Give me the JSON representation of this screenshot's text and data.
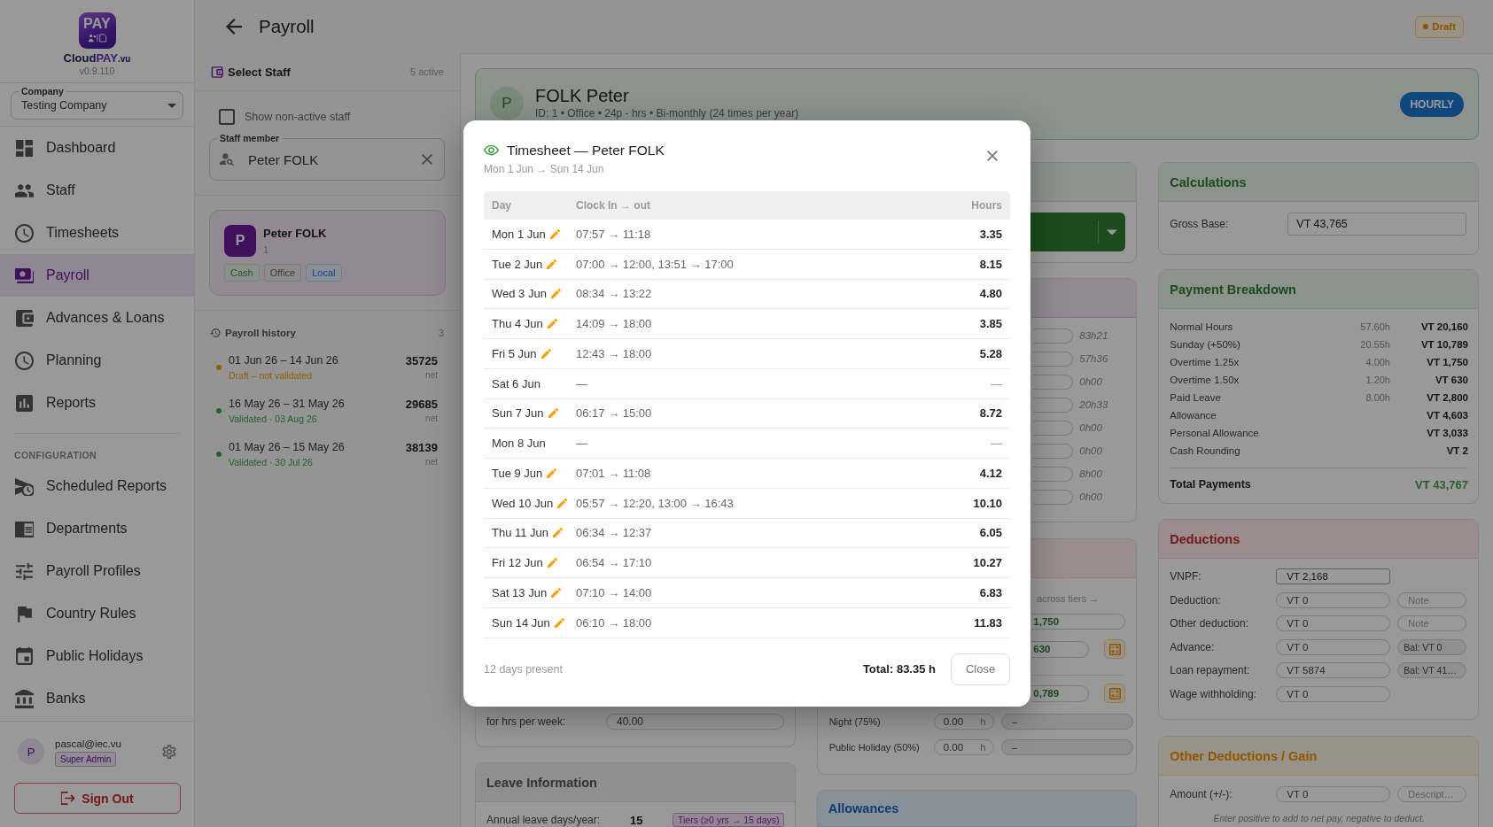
{
  "sidebar": {
    "logo_text": "PAY",
    "brand": {
      "name": "Cloud",
      "accent": "PAY",
      "suffix": ".vu"
    },
    "version": "v0.9.110",
    "company": {
      "label": "Company",
      "value": "Testing Company"
    },
    "sections": [
      {
        "items": [
          {
            "label": "Dashboard",
            "selected": false
          },
          {
            "label": "Staff",
            "selected": false
          },
          {
            "label": "Timesheets",
            "selected": false
          },
          {
            "label": "Payroll",
            "selected": true
          },
          {
            "label": "Advances & Loans",
            "selected": false
          },
          {
            "label": "Planning",
            "selected": false
          },
          {
            "label": "Reports",
            "selected": false
          }
        ]
      },
      {
        "heading": "CONFIGURATION",
        "items": [
          {
            "label": "Scheduled Reports",
            "selected": false
          },
          {
            "label": "Departments",
            "selected": false
          },
          {
            "label": "Payroll Profiles",
            "selected": false
          },
          {
            "label": "Country Rules",
            "selected": false
          },
          {
            "label": "Public Holidays",
            "selected": false
          },
          {
            "label": "Banks",
            "selected": false
          }
        ]
      }
    ],
    "user": {
      "initial": "P",
      "email": "pascal@iec.vu",
      "role": "Super Admin"
    },
    "sign_out": "Sign Out"
  },
  "header": {
    "title": "Payroll",
    "status": "Draft"
  },
  "staff_panel": {
    "title": "Select Staff",
    "count": "5 active",
    "show_inactive": {
      "label": "Show non-active staff",
      "checked": false
    },
    "staff_field": {
      "label": "Staff member",
      "value": "Peter FOLK"
    },
    "selected_staff": {
      "initial": "P",
      "name": "Peter FOLK",
      "id": "1",
      "tags": [
        {
          "label": "Cash",
          "color": "#8a918b"
        },
        {
          "label": "Office",
          "color": "#8d8d8d"
        },
        {
          "label": "Local",
          "color": "#888f97"
        }
      ]
    },
    "history": {
      "title": "Payroll history",
      "count": "3",
      "entries": [
        {
          "period": "01 Jun 26 – 14 Jun 26",
          "status": "Draft – not validated",
          "color": "#915e07",
          "net": "35725",
          "net_label": "net"
        },
        {
          "period": "16 May 26 – 31 May 26",
          "status": "Validated · 03 Aug 26",
          "color": "#28602b",
          "net": "29685",
          "net_label": "net"
        },
        {
          "period": "01 May 26 – 15 May 26",
          "status": "Validated · 30 Jul 26",
          "color": "#28602b",
          "net": "38139",
          "net_label": "net"
        }
      ]
    }
  },
  "employee": {
    "initial": "P",
    "name": "FOLK Peter",
    "details": "ID: 1 • Office • 24p - hrs • Bi-monthly (24 times per year)",
    "pay_type": "HOURLY"
  },
  "work_card": {
    "hours_per_week": {
      "label": "for hrs per week:",
      "value": "40.00"
    }
  },
  "leave_card": {
    "title": "Leave Information",
    "annual_leave": {
      "label": "Annual leave days/year:",
      "value": "15",
      "tier": "Tiers (≥0 yrs → 15 days)"
    }
  },
  "time_card": {
    "durations": [
      "83h21",
      "57h36",
      "0h00",
      "20h33",
      "0h00",
      "0h00",
      "8h00",
      "0h00"
    ]
  },
  "rates_card": {
    "hint": "across tiers →",
    "groups": [
      [
        {
          "kind": "full",
          "value": "1,750"
        },
        {
          "kind": "action",
          "value": "630"
        }
      ],
      [
        {
          "kind": "action",
          "value": "0,789"
        }
      ]
    ],
    "extra_rows": [
      {
        "label": "Night (75%)",
        "hours": "0.00",
        "unit": "h",
        "amount": "–"
      },
      {
        "label": "Public Holiday (50%)",
        "hours": "0.00",
        "unit": "h",
        "amount": "–"
      }
    ]
  },
  "allowances_card": {
    "title": "Allowances"
  },
  "calculations": {
    "title": "Calculations",
    "gross_base": {
      "label": "Gross Base:",
      "value": "VT 43,765"
    }
  },
  "payment_breakdown": {
    "title": "Payment Breakdown",
    "rows": [
      {
        "label": "Normal Hours",
        "hours": "57.60h",
        "amount": "VT 20,160"
      },
      {
        "label": "Sunday (+50%)",
        "hours": "20.55h",
        "amount": "VT 10,789"
      },
      {
        "label": "Overtime 1.25x",
        "hours": "4.00h",
        "amount": "VT 1,750"
      },
      {
        "label": "Overtime 1.50x",
        "hours": "1.20h",
        "amount": "VT 630"
      },
      {
        "label": "Paid Leave",
        "hours": "8.00h",
        "amount": "VT 2,800"
      },
      {
        "label": "Allowance",
        "amount": "VT 4,603"
      },
      {
        "label": "Personal Allowance",
        "amount": "VT 3,033"
      },
      {
        "label": "Cash Rounding",
        "amount": "VT 2"
      }
    ],
    "total": {
      "label": "Total Payments",
      "amount": "VT 43,767"
    }
  },
  "deductions": {
    "title": "Deductions",
    "rows": [
      {
        "kind": "readonly",
        "label": "VNPF:",
        "value": "VT 2,168"
      },
      {
        "kind": "note",
        "label": "Deduction:",
        "value": "VT 0",
        "placeholder": "Note"
      },
      {
        "kind": "note",
        "label": "Other deduction:",
        "value": "VT 0",
        "placeholder": "Note"
      },
      {
        "kind": "balance",
        "label": "Advance:",
        "value": "VT 0",
        "balance": "Bal: VT 0"
      },
      {
        "kind": "balance",
        "label": "Loan repayment:",
        "value": "VT 5874",
        "balance": "Bal: VT 41…"
      },
      {
        "kind": "input",
        "label": "Wage withholding:",
        "value": "VT 0"
      }
    ]
  },
  "other_deductions": {
    "title": "Other Deductions / Gain",
    "amount": {
      "label": "Amount (+/-):",
      "value": "VT 0",
      "placeholder": "Descript…"
    },
    "hint": "Enter positive to add to net pay, negative to deduct."
  },
  "timesheet_dialog": {
    "title": "Timesheet — Peter FOLK",
    "range": "Mon 1 Jun → Sun 14 Jun",
    "columns": [
      "Day",
      "Clock In → out",
      "Hours"
    ],
    "rows": [
      {
        "day": "Mon 1 Jun",
        "present": true,
        "clock": "07:57 → 11:18",
        "hours": "3.35"
      },
      {
        "day": "Tue 2 Jun",
        "present": true,
        "clock": "07:00 → 12:00, 13:51 → 17:00",
        "hours": "8.15"
      },
      {
        "day": "Wed 3 Jun",
        "present": true,
        "clock": "08:34 → 13:22",
        "hours": "4.80"
      },
      {
        "day": "Thu 4 Jun",
        "present": true,
        "clock": "14:09 → 18:00",
        "hours": "3.85"
      },
      {
        "day": "Fri 5 Jun",
        "present": true,
        "clock": "12:43 → 18:00",
        "hours": "5.28"
      },
      {
        "day": "Sat 6 Jun",
        "present": false,
        "clock": "—",
        "hours": "—"
      },
      {
        "day": "Sun 7 Jun",
        "present": true,
        "clock": "06:17 → 15:00",
        "hours": "8.72"
      },
      {
        "day": "Mon 8 Jun",
        "present": false,
        "clock": "—",
        "hours": "—"
      },
      {
        "day": "Tue 9 Jun",
        "present": true,
        "clock": "07:01 → 11:08",
        "hours": "4.12"
      },
      {
        "day": "Wed 10 Jun",
        "present": true,
        "clock": "05:57 → 12:20, 13:00 → 16:43",
        "hours": "10.10"
      },
      {
        "day": "Thu 11 Jun",
        "present": true,
        "clock": "06:34 → 12:37",
        "hours": "6.05"
      },
      {
        "day": "Fri 12 Jun",
        "present": true,
        "clock": "06:54 → 17:10",
        "hours": "10.27"
      },
      {
        "day": "Sat 13 Jun",
        "present": true,
        "clock": "07:10 → 14:00",
        "hours": "6.83"
      },
      {
        "day": "Sun 14 Jun",
        "present": true,
        "clock": "06:10 → 18:00",
        "hours": "11.83"
      }
    ],
    "summary": "12 days present",
    "total": "Total: 83.35 h",
    "close_label": "Close"
  }
}
